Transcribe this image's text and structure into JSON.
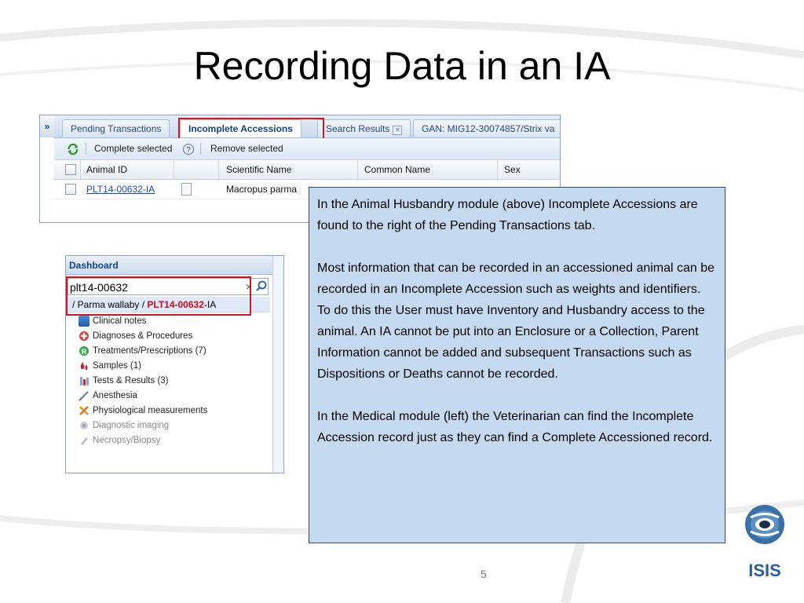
{
  "slide": {
    "title": "Recording Data in an IA",
    "page_number": "5",
    "logo_text": "ISIS"
  },
  "animal_husbandry": {
    "collapse_glyph": "»",
    "tabs": [
      {
        "label": "Pending Transactions",
        "active": false
      },
      {
        "label": "Incomplete Accessions",
        "active": true
      },
      {
        "label": "Search Results",
        "active": false,
        "closable": true
      },
      {
        "label": "GAN: MIG12-30074857/Strix va",
        "active": false
      }
    ],
    "toolbar": {
      "complete_selected": "Complete selected",
      "remove_selected": "Remove selected"
    },
    "columns": [
      "Animal ID",
      "Scientific Name",
      "Common Name",
      "Sex"
    ],
    "rows": [
      {
        "animal_id": "PLT14-00632-IA",
        "scientific_name": "Macropus parma"
      }
    ]
  },
  "dashboard": {
    "title": "Dashboard",
    "search_value": "plt14-00632",
    "clear_glyph": "×",
    "suggestion": {
      "prefix": "/ Parma wallaby / ",
      "id_highlight": "PLT14-00632",
      "suffix": "-IA"
    },
    "items": [
      {
        "label": "Clinical notes",
        "icon": "clinical-notes-icon",
        "enabled": true
      },
      {
        "label": "Diagnoses & Procedures",
        "icon": "diagnoses-icon",
        "enabled": true
      },
      {
        "label": "Treatments/Prescriptions (7)",
        "icon": "prescription-icon",
        "enabled": true
      },
      {
        "label": "Samples (1)",
        "icon": "samples-icon",
        "enabled": true
      },
      {
        "label": "Tests & Results (3)",
        "icon": "tests-icon",
        "enabled": true
      },
      {
        "label": "Anesthesia",
        "icon": "syringe-icon",
        "enabled": true
      },
      {
        "label": "Physiological measurements",
        "icon": "measurements-icon",
        "enabled": true
      },
      {
        "label": "Diagnostic imaging",
        "icon": "imaging-icon",
        "enabled": false
      },
      {
        "label": "Necropsy/Biopsy",
        "icon": "necropsy-icon",
        "enabled": false
      }
    ]
  },
  "note": {
    "paragraph1": "In the Animal Husbandry module (above) Incomplete Accessions are found to the right of the Pending Transactions tab.",
    "paragraph2": "Most information that can be recorded in an accessioned animal can be recorded in an Incomplete Accession such as weights and identifiers. To do this the User must have Inventory and Husbandry access to the animal. An IA cannot be put into an  Enclosure or a Collection, Parent Information cannot be added and subsequent Transactions such as Dispositions or Deaths cannot be recorded.",
    "paragraph3": "In the Medical module (left) the Veterinarian can find the Incomplete Accession record just as they can find a Complete Accessioned record."
  },
  "colors": {
    "highlight_red": "#d7141f",
    "note_background": "#c5d9f0",
    "link_blue": "#1a4bcf"
  }
}
